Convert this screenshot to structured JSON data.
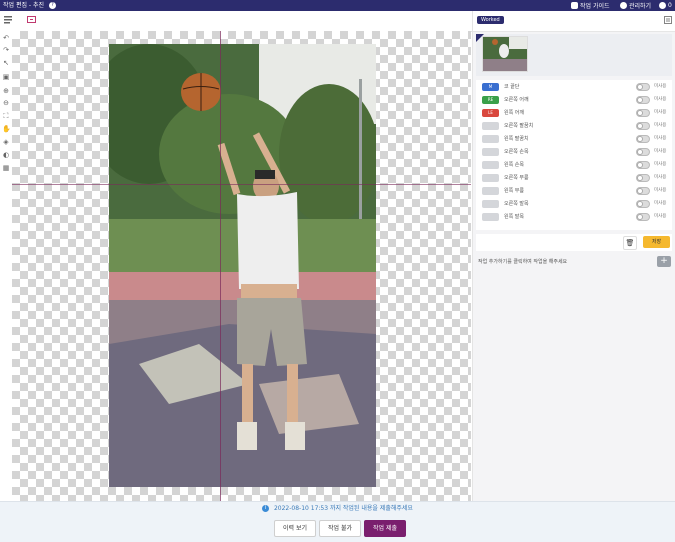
{
  "topbar": {
    "title": "작업 편집 - 추진",
    "help": "?",
    "guide_label": "작업 가이드",
    "profile_label": "관리하기",
    "bell": "0"
  },
  "right_panel": {
    "tag": "Worked",
    "layers": [
      {
        "chip": "M",
        "color": "#3a6fd0",
        "name": "코 끝단",
        "toggle_label": "미사용"
      },
      {
        "chip": "RE",
        "color": "#3aa04a",
        "name": "오른쪽 어깨",
        "toggle_label": "미사용"
      },
      {
        "chip": "LE",
        "color": "#d9483e",
        "name": "왼쪽 어깨",
        "toggle_label": "미사용"
      },
      {
        "chip": "",
        "color": "#d4d6da",
        "name": "오른쪽 팔꿈치",
        "toggle_label": "미사용"
      },
      {
        "chip": "",
        "color": "#d4d6da",
        "name": "왼쪽 팔꿈치",
        "toggle_label": "미사용"
      },
      {
        "chip": "",
        "color": "#d4d6da",
        "name": "오른쪽 손목",
        "toggle_label": "미사용"
      },
      {
        "chip": "",
        "color": "#d4d6da",
        "name": "왼쪽 손목",
        "toggle_label": "미사용"
      },
      {
        "chip": "",
        "color": "#d4d6da",
        "name": "오른쪽 무릎",
        "toggle_label": "미사용"
      },
      {
        "chip": "",
        "color": "#d4d6da",
        "name": "왼쪽 무릎",
        "toggle_label": "미사용"
      },
      {
        "chip": "",
        "color": "#d4d6da",
        "name": "오른쪽 발목",
        "toggle_label": "미사용"
      },
      {
        "chip": "",
        "color": "#d4d6da",
        "name": "왼쪽 발목",
        "toggle_label": "미사용"
      }
    ],
    "save_label": "저장",
    "add_text": "작업 추가하기를 클릭하여 작업을 해주세요"
  },
  "status": {
    "message": "2022-08-10 17:53 까지 작업된 내용을 제출해주세요",
    "buttons": [
      "이력 보기",
      "작업 불가",
      "작업 제출"
    ]
  },
  "colors": {
    "header": "#2c2c6e",
    "accent_primary": "#7a1f6e",
    "save": "#f5b82e"
  }
}
